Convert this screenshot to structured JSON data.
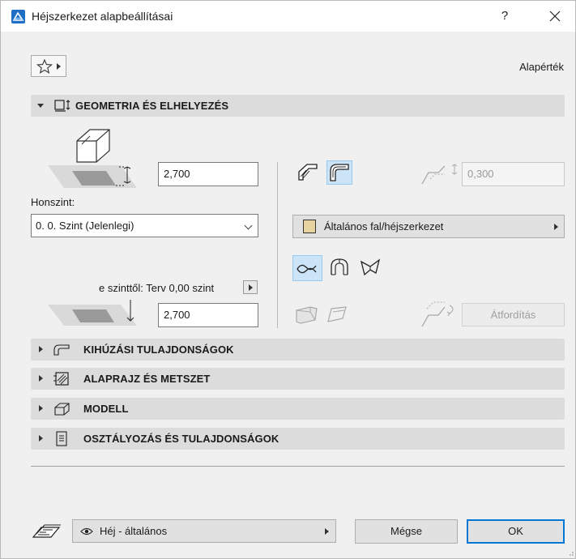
{
  "window": {
    "title": "Héjszerkezet alapbeállításai",
    "help_label": "?",
    "close_label": "×"
  },
  "header": {
    "default_label": "Alapérték"
  },
  "geometry": {
    "section_label": "GEOMETRIA ÉS ELHELYEZÉS",
    "top_height": "2,700",
    "home_story_label": "Honszint:",
    "home_story_value": "0. 0. Szint (Jelenlegi)",
    "offset_label": "e szinttől: Terv 0,00 szint",
    "bottom_height": "2,700",
    "thickness_value": "0,300",
    "structure_value": "Általános fal/héjszerkezet",
    "flip_label": "Átfordítás"
  },
  "sections": {
    "extrusion_label": "KIHÚZÁSI TULAJDONSÁGOK",
    "plan_label": "ALAPRAJZ ÉS METSZET",
    "model_label": "MODELL",
    "classification_label": "OSZTÁLYOZÁS ÉS TULAJDONSÁGOK"
  },
  "footer": {
    "layer_value": "Héj - általános",
    "cancel_label": "Mégse",
    "ok_label": "OK"
  },
  "colors": {
    "accent": "#0078d7",
    "selected_bg": "#cce4f7",
    "section_bg": "#dcdcdc",
    "app_icon": "#1f6fc5"
  }
}
